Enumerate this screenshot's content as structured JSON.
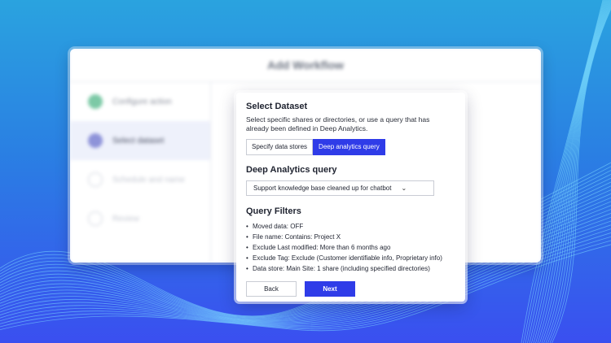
{
  "background_window": {
    "title": "Add Workflow",
    "steps": [
      {
        "label": "Configure action",
        "state": "done"
      },
      {
        "label": "Select dataset",
        "state": "active"
      },
      {
        "label": "Schedule and name",
        "state": "pending"
      },
      {
        "label": "Review",
        "state": "pending"
      }
    ]
  },
  "dialog": {
    "title": "Select Dataset",
    "description": "Select specific shares or directories, or use a query that has already been defined in Deep Analytics.",
    "tabs": [
      {
        "label": "Specify data stores",
        "active": false
      },
      {
        "label": "Deep analytics query",
        "active": true
      }
    ],
    "query_section_title": "Deep Analytics query",
    "query_select_value": "Support knowledge base cleaned up for chatbot",
    "filters_title": "Query Filters",
    "filters": [
      "Moved data: OFF",
      "File name: Contains: Project X",
      "Exclude Last modified: More than 6 months ago",
      "Exclude Tag: Exclude (Customer identifiable info, Proprietary info)",
      "Data store: Main Site: 1 share (including specified directories)"
    ],
    "back_label": "Back",
    "next_label": "Next"
  },
  "colors": {
    "accent": "#2f3ce8",
    "bg_top": "#2aa3df",
    "bg_bottom": "#3a4ff0"
  }
}
